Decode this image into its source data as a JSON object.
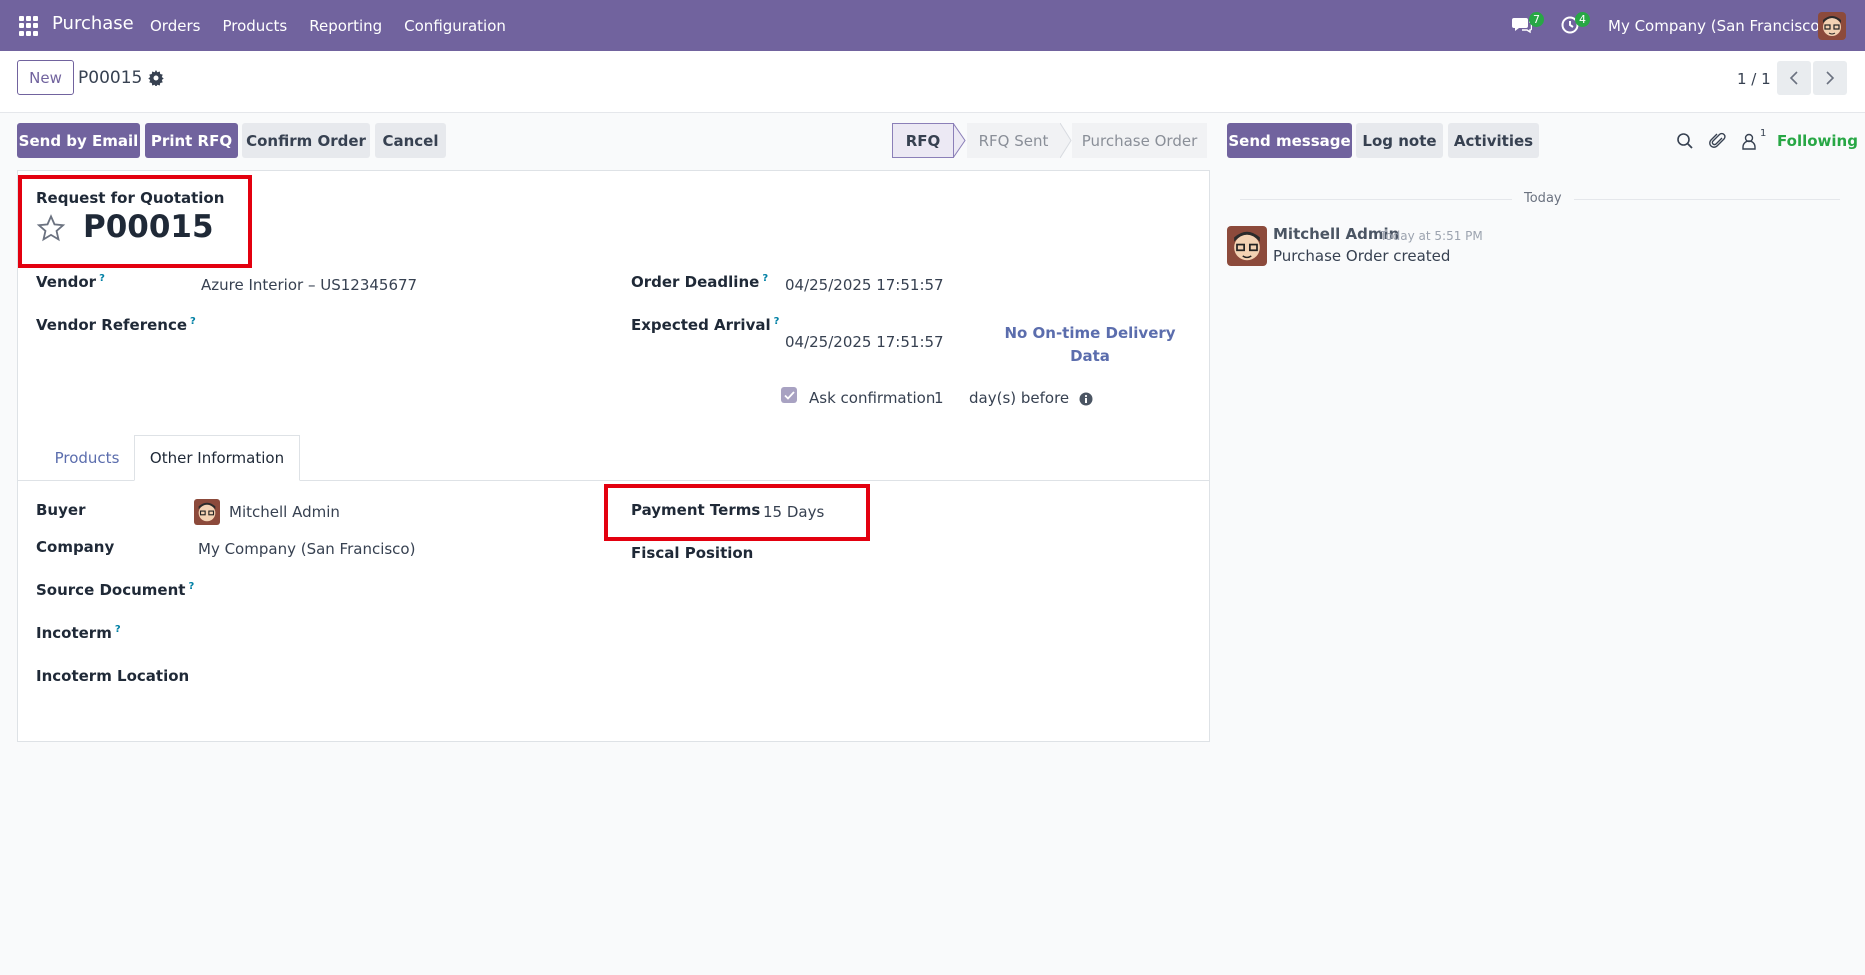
{
  "navbar": {
    "brand": "Purchase",
    "menu": [
      "Orders",
      "Products",
      "Reporting",
      "Configuration"
    ],
    "messages_count": "7",
    "activities_count": "4",
    "company": "My Company (San Francisco)"
  },
  "control": {
    "new_label": "New",
    "record_name": "P00015",
    "pager": "1 / 1"
  },
  "actions": {
    "send_email": "Send by Email",
    "print_rfq": "Print RFQ",
    "confirm_order": "Confirm Order",
    "cancel": "Cancel"
  },
  "statusbar": {
    "stages": [
      "RFQ",
      "RFQ Sent",
      "Purchase Order"
    ],
    "current": "RFQ"
  },
  "form": {
    "doc_type": "Request for Quotation",
    "name": "P00015",
    "vendor_label": "Vendor",
    "vendor_value": "Azure Interior – US12345677",
    "vendor_ref_label": "Vendor Reference",
    "order_deadline_label": "Order Deadline",
    "order_deadline_value": "04/25/2025 17:51:57",
    "expected_arrival_label": "Expected Arrival",
    "expected_arrival_value": "04/25/2025 17:51:57",
    "no_ontime_line1": "No On-time Delivery",
    "no_ontime_line2": "Data",
    "ask_confirmation_label": "Ask confirmation",
    "ask_confirmation_days": "1",
    "days_before": "day(s) before",
    "help_mark": "?"
  },
  "tabs": {
    "products": "Products",
    "other_info": "Other Information"
  },
  "other_info": {
    "buyer_label": "Buyer",
    "buyer_value": "Mitchell Admin",
    "company_label": "Company",
    "company_value": "My Company (San Francisco)",
    "source_doc_label": "Source Document",
    "incoterm_label": "Incoterm",
    "incoterm_location_label": "Incoterm Location",
    "payment_terms_label": "Payment Terms",
    "payment_terms_value": "15 Days",
    "fiscal_position_label": "Fiscal Position"
  },
  "chatter": {
    "send_message": "Send message",
    "log_note": "Log note",
    "activities": "Activities",
    "followers_count": "1",
    "following": "Following",
    "today": "Today",
    "author": "Mitchell Admin",
    "time": "Today at 5:51 PM",
    "message": "Purchase Order created"
  },
  "colors": {
    "brand": "#71639e",
    "highlight": "#e3000f",
    "following": "#28a745"
  }
}
